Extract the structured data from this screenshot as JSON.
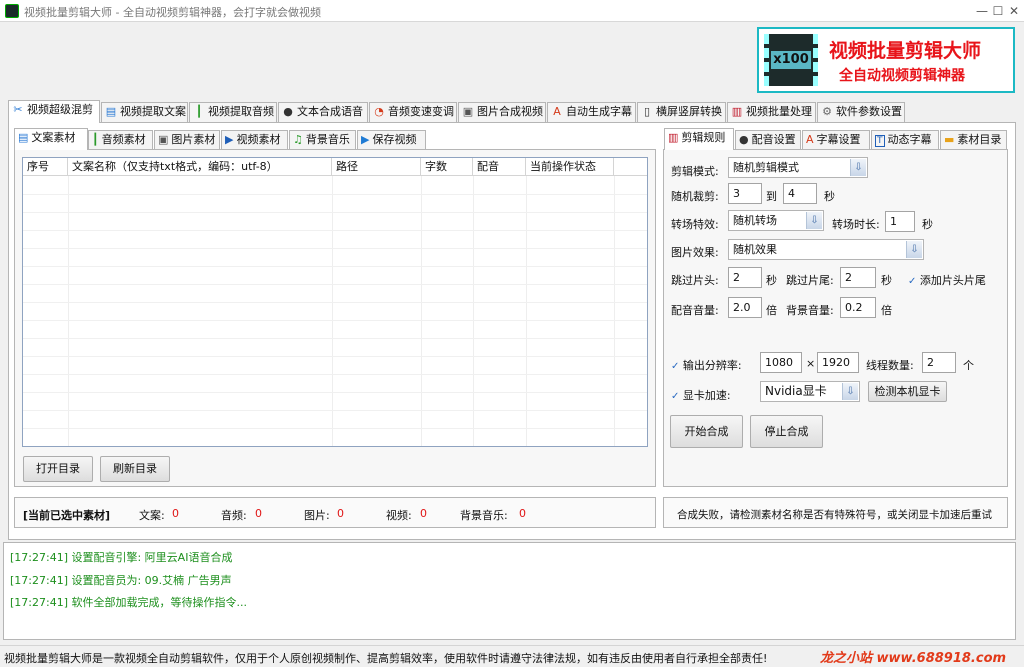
{
  "window": {
    "title": "视频批量剪辑大师 - 全自动视频剪辑神器，会打字就会做视频",
    "minimize": "—",
    "maximize": "☐",
    "close": "✕"
  },
  "banner": {
    "logo_text": "x100",
    "line1": "视频批量剪辑大师",
    "line2": "全自动视频剪辑神器",
    "accent_color": "#e8141a",
    "border_color": "#1cb9c4"
  },
  "main_tabs": [
    {
      "label": "视频超级混剪",
      "icon": "scissors-icon",
      "glyph": "✂"
    },
    {
      "label": "视频提取文案",
      "icon": "document-icon",
      "glyph": "▤"
    },
    {
      "label": "视频提取音频",
      "icon": "waveform-icon",
      "glyph": "┃"
    },
    {
      "label": "文本合成语音",
      "icon": "microphone-icon",
      "glyph": "●"
    },
    {
      "label": "音频变速变调",
      "icon": "gauge-icon",
      "glyph": "◔"
    },
    {
      "label": "图片合成视频",
      "icon": "image-icon",
      "glyph": "▣"
    },
    {
      "label": "自动生成字幕",
      "icon": "font-icon",
      "glyph": "A"
    },
    {
      "label": "横屏竖屏转换",
      "icon": "rotate-icon",
      "glyph": "▯"
    },
    {
      "label": "视频批量处理",
      "icon": "film-icon",
      "glyph": "▥"
    },
    {
      "label": "软件参数设置",
      "icon": "gear-icon",
      "glyph": "⚙"
    }
  ],
  "left_tabs": [
    {
      "label": "文案素材",
      "icon": "document-icon",
      "glyph": "▤"
    },
    {
      "label": "音频素材",
      "icon": "waveform-icon",
      "glyph": "┃"
    },
    {
      "label": "图片素材",
      "icon": "image-icon",
      "glyph": "▣"
    },
    {
      "label": "视频素材",
      "icon": "play-icon",
      "glyph": "▶"
    },
    {
      "label": "背景音乐",
      "icon": "music-icon",
      "glyph": "♫"
    },
    {
      "label": "保存视频",
      "icon": "play-box-icon",
      "glyph": "▶"
    }
  ],
  "table": {
    "columns": [
      "序号",
      "文案名称（仅支持txt格式，编码：utf-8）",
      "路径",
      "字数",
      "配音",
      "当前操作状态"
    ]
  },
  "left_buttons": {
    "open": "打开目录",
    "refresh": "刷新目录"
  },
  "right_tabs": [
    {
      "label": "剪辑规则",
      "icon": "film-icon",
      "glyph": "▥"
    },
    {
      "label": "配音设置",
      "icon": "microphone-icon",
      "glyph": "●"
    },
    {
      "label": "字幕设置",
      "icon": "font-icon",
      "glyph": "A"
    },
    {
      "label": "动态字幕",
      "icon": "text-box-icon",
      "glyph": "T"
    },
    {
      "label": "素材目录",
      "icon": "folder-icon",
      "glyph": "▬"
    }
  ],
  "rules": {
    "mode_label": "剪辑模式:",
    "mode_value": "随机剪辑模式",
    "random_cut_label": "随机裁剪:",
    "random_from": "3",
    "to_label": "到",
    "random_to": "4",
    "sec": "秒",
    "transition_label": "转场特效:",
    "transition_value": "随机转场",
    "transition_dur_label": "转场时长:",
    "transition_dur": "1",
    "image_effect_label": "图片效果:",
    "image_effect_value": "随机效果",
    "skip_head_label": "跳过片头:",
    "skip_head": "2",
    "skip_tail_label": "跳过片尾:",
    "skip_tail": "2",
    "add_head_tail_label": "添加片头片尾",
    "dub_vol_label": "配音音量:",
    "dub_vol": "2.0",
    "times": "倍",
    "bg_vol_label": "背景音量:",
    "bg_vol": "0.2",
    "resolution_label": "输出分辨率:",
    "res_w": "1080",
    "res_x": "×",
    "res_h": "1920",
    "threads_label": "线程数量:",
    "threads": "2",
    "unit_ge": "个",
    "gpu_label": "显卡加速:",
    "gpu_value": "Nvidia显卡",
    "detect_gpu": "检测本机显卡",
    "start": "开始合成",
    "stop": "停止合成"
  },
  "status": {
    "selected_label": "[当前已选中素材]",
    "items": [
      {
        "label": "文案:",
        "value": "0"
      },
      {
        "label": "音频:",
        "value": "0"
      },
      {
        "label": "图片:",
        "value": "0"
      },
      {
        "label": "视频:",
        "value": "0"
      },
      {
        "label": "背景音乐:",
        "value": "0"
      }
    ],
    "message": "合成失败，请检测素材名称是否有特殊符号，或关闭显卡加速后重试"
  },
  "log": [
    "[17:27:41] 设置配音引擎:  阿里云AI语音合成",
    "[17:27:41] 设置配音员为: 09.艾楠 广告男声",
    "[17:27:41] 软件全部加载完成，等待操作指令..."
  ],
  "footer": {
    "text": "视频批量剪辑大师是一款视频全自动剪辑软件，仅用于个人原创视频制作、提高剪辑效率，使用软件时请遵守法律法规，如有违反由使用者自行承担全部责任!",
    "site": "龙之小站 www.688918.com"
  }
}
